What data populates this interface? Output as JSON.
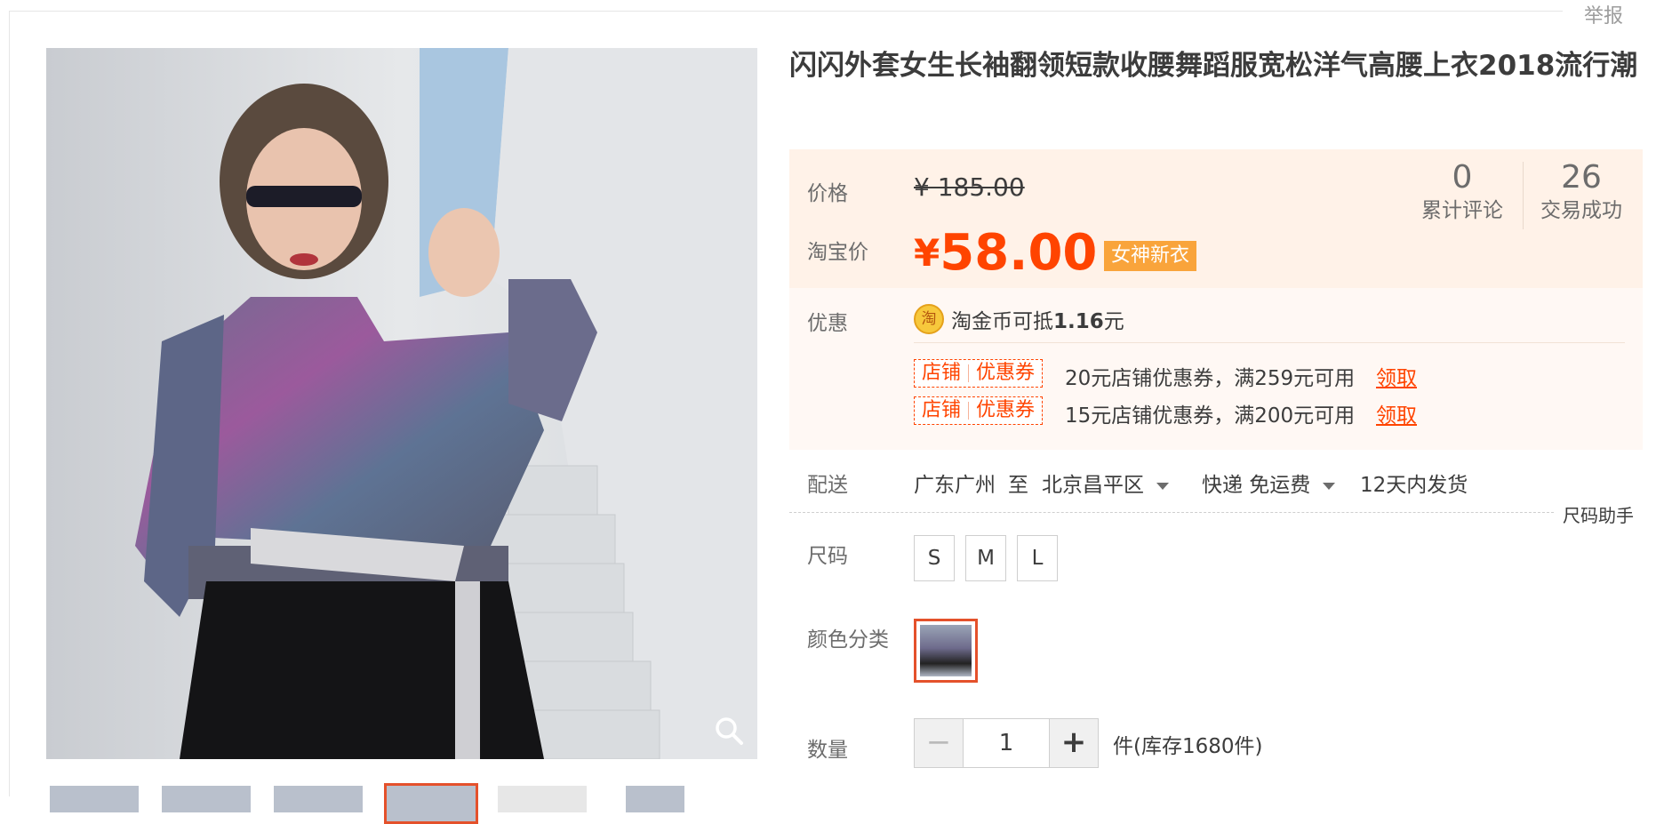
{
  "header": {
    "report_label": "举报"
  },
  "product": {
    "title": "闪闪外套女生长袖翻领短款收腰舞蹈服宽松洋气高腰上衣2018流行潮"
  },
  "price": {
    "price_label": "价格",
    "original_price": "¥ 185.00",
    "taobao_label": "淘宝价",
    "currency": "¥",
    "taobao_price": "58.00",
    "badge": "女神新衣",
    "review_count": "0",
    "review_label": "累计评论",
    "deal_count": "26",
    "deal_label": "交易成功"
  },
  "promo": {
    "label": "优惠",
    "coin_icon_text": "淘",
    "coin_text_prefix": "淘金币可抵",
    "coin_amount": "1.16",
    "coin_text_suffix": "元",
    "coupons": [
      {
        "tag_left": "店铺",
        "tag_right": "优惠券",
        "text": "20元店铺优惠券，满259元可用",
        "claim": "领取"
      },
      {
        "tag_left": "店铺",
        "tag_right": "优惠券",
        "text": "15元店铺优惠券，满200元可用",
        "claim": "领取"
      }
    ]
  },
  "delivery": {
    "label": "配送",
    "from": "广东广州",
    "to_word": "至",
    "destination": "北京昌平区",
    "method": "快递 免运费",
    "ship_time": "12天内发货"
  },
  "size": {
    "help_label": "尺码助手",
    "label": "尺码",
    "options": [
      "S",
      "M",
      "L"
    ]
  },
  "color": {
    "label": "颜色分类"
  },
  "quantity": {
    "label": "数量",
    "minus": "−",
    "value": "1",
    "plus": "+",
    "stock_text": "件(库存1680件)"
  },
  "icons": {
    "zoom": "magnifier-icon",
    "coin": "taobao-coin-icon",
    "dropdown": "caret-down-icon"
  },
  "colors": {
    "accent": "#ff4400",
    "badge_bg": "#f9a43b",
    "price_bg": "#fff2e8",
    "promo_bg": "#fff8f4"
  }
}
